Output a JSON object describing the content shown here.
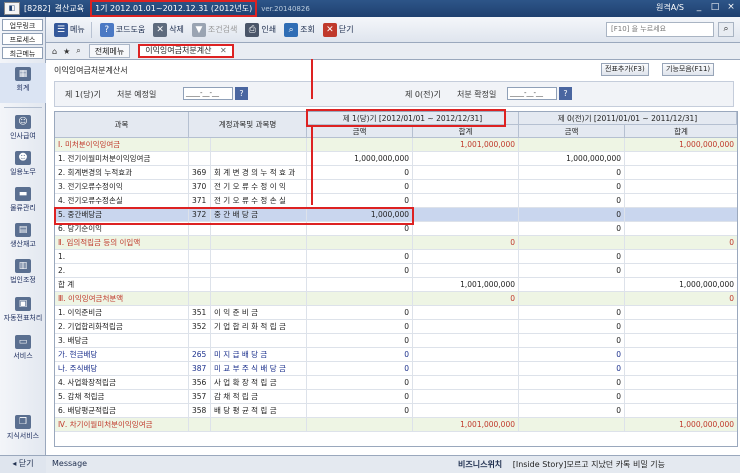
{
  "titlebar": {
    "code": "[8282]",
    "company": "결산교육",
    "period": "1기 2012.01.01~2012.12.31 (2012년도)",
    "version": "ver.20140826",
    "right_link": "원격A/S"
  },
  "leftpanel": {
    "tabs": [
      "업무링크",
      "프로세스",
      "최근메뉴"
    ],
    "items": [
      "회계",
      "인사급여",
      "일용노무",
      "물류관리",
      "생산재고",
      "법인조정",
      "자동전표처리",
      "서비스",
      "지식서비스"
    ],
    "close_label": "닫기"
  },
  "toolbar": {
    "menu": "메뉴",
    "code_help": "코드도움",
    "delete": "삭제",
    "condition": "조건검색",
    "print": "인쇄",
    "search": "조회",
    "close": "닫기",
    "f10_placeholder": "[F10] 을 누르세요"
  },
  "tabs": {
    "all_menu": "전체메뉴",
    "current": "이익잉여금처분계산"
  },
  "page": {
    "title": "이익잉여금처분계산서",
    "btn_carry": "전표추가(F3)",
    "btn_funcs": "기능모음(F11)",
    "cur_label": "제 1(당)기",
    "cur_date_label": "처분 예정일",
    "cur_date_value": "____-__-__",
    "prev_label": "제 0(전)기",
    "prev_date_label": "처분 확정일",
    "prev_date_value": "____-__-__"
  },
  "grid": {
    "headers": {
      "category": "과목",
      "account": "계정과목및 과목명",
      "current_period": "제 1(당)기 [2012/01/01 ~ 2012/12/31]",
      "previous_period": "제 0(전)기 [2011/01/01 ~ 2011/12/31]",
      "amount": "금액",
      "total": "합계"
    },
    "rows": [
      {
        "name": "Ⅰ. 미처분이익잉여금",
        "code": "",
        "acct": "",
        "cur": "",
        "curtot": "1,001,000,000",
        "prev": "",
        "prevtot": "1,000,000,000",
        "type": "sec"
      },
      {
        "name": "   1. 전기이월미처분이익잉여금",
        "code": "",
        "acct": "",
        "cur": "1,000,000,000",
        "curtot": "",
        "prev": "1,000,000,000",
        "prevtot": "",
        "type": ""
      },
      {
        "name": "   2. 회계변경의 누적효과",
        "code": "369",
        "acct": "회 계 변 경 의 누 적 효 과",
        "cur": "0",
        "curtot": "",
        "prev": "0",
        "prevtot": "",
        "type": ""
      },
      {
        "name": "   3. 전기오류수정이익",
        "code": "370",
        "acct": "전 기 오 류 수 정 이 익",
        "cur": "0",
        "curtot": "",
        "prev": "0",
        "prevtot": "",
        "type": ""
      },
      {
        "name": "   4. 전기오류수정손실",
        "code": "371",
        "acct": "전 기 오 류 수 정 손 실",
        "cur": "0",
        "curtot": "",
        "prev": "0",
        "prevtot": "",
        "type": ""
      },
      {
        "name": "   5. 중간배당금",
        "code": "372",
        "acct": "중 간 배 당 금",
        "cur": "1,000,000",
        "curtot": "",
        "prev": "0",
        "prevtot": "",
        "type": "hl"
      },
      {
        "name": "   6. 당기순이익",
        "code": "",
        "acct": "",
        "cur": "0",
        "curtot": "",
        "prev": "0",
        "prevtot": "",
        "type": ""
      },
      {
        "name": "Ⅱ. 임의적립금 등의 이입액",
        "code": "",
        "acct": "",
        "cur": "",
        "curtot": "0",
        "prev": "",
        "prevtot": "0",
        "type": "sec"
      },
      {
        "name": "   1.",
        "code": "",
        "acct": "",
        "cur": "0",
        "curtot": "",
        "prev": "0",
        "prevtot": "",
        "type": ""
      },
      {
        "name": "   2.",
        "code": "",
        "acct": "",
        "cur": "0",
        "curtot": "",
        "prev": "0",
        "prevtot": "",
        "type": ""
      },
      {
        "name": "합 계",
        "code": "",
        "acct": "",
        "cur": "",
        "curtot": "1,001,000,000",
        "prev": "",
        "prevtot": "1,000,000,000",
        "type": ""
      },
      {
        "name": "Ⅲ. 이익잉여금처분액",
        "code": "",
        "acct": "",
        "cur": "",
        "curtot": "0",
        "prev": "",
        "prevtot": "0",
        "type": "sec"
      },
      {
        "name": "   1. 이익준비금",
        "code": "351",
        "acct": "이 익 준 비 금",
        "cur": "0",
        "curtot": "",
        "prev": "0",
        "prevtot": "",
        "type": ""
      },
      {
        "name": "   2. 기업합리화적립금",
        "code": "352",
        "acct": "기 업 합 리 화 적 립 금",
        "cur": "0",
        "curtot": "",
        "prev": "0",
        "prevtot": "",
        "type": ""
      },
      {
        "name": "   3. 배당금",
        "code": "",
        "acct": "",
        "cur": "0",
        "curtot": "",
        "prev": "0",
        "prevtot": "",
        "type": ""
      },
      {
        "name": "      가. 현금배당",
        "code": "265",
        "acct": "미 지 급 배 당 금",
        "cur": "0",
        "curtot": "",
        "prev": "0",
        "prevtot": "",
        "type": "sub2"
      },
      {
        "name": "      나. 주식배당",
        "code": "387",
        "acct": "미 교 부 주 식 배 당 금",
        "cur": "0",
        "curtot": "",
        "prev": "0",
        "prevtot": "",
        "type": "sub2"
      },
      {
        "name": "   4. 사업확장적립금",
        "code": "356",
        "acct": "사 업 확 장 적 립 금",
        "cur": "0",
        "curtot": "",
        "prev": "0",
        "prevtot": "",
        "type": ""
      },
      {
        "name": "   5. 감채 적립금",
        "code": "357",
        "acct": "감 채 적 립 금",
        "cur": "0",
        "curtot": "",
        "prev": "0",
        "prevtot": "",
        "type": ""
      },
      {
        "name": "   6. 배당평균적립금",
        "code": "358",
        "acct": "배 당 평 균 적 립 금",
        "cur": "0",
        "curtot": "",
        "prev": "0",
        "prevtot": "",
        "type": ""
      },
      {
        "name": "Ⅳ. 차기이월미처분이익잉여금",
        "code": "",
        "acct": "",
        "cur": "",
        "curtot": "1,001,000,000",
        "prev": "",
        "prevtot": "1,000,000,000",
        "type": "sec"
      }
    ]
  },
  "statusbar": {
    "message": "Message",
    "biz_label": "비즈니스위치",
    "biz_text": "[Inside Story]모르고 지났던 카톡 비밀 기능"
  }
}
